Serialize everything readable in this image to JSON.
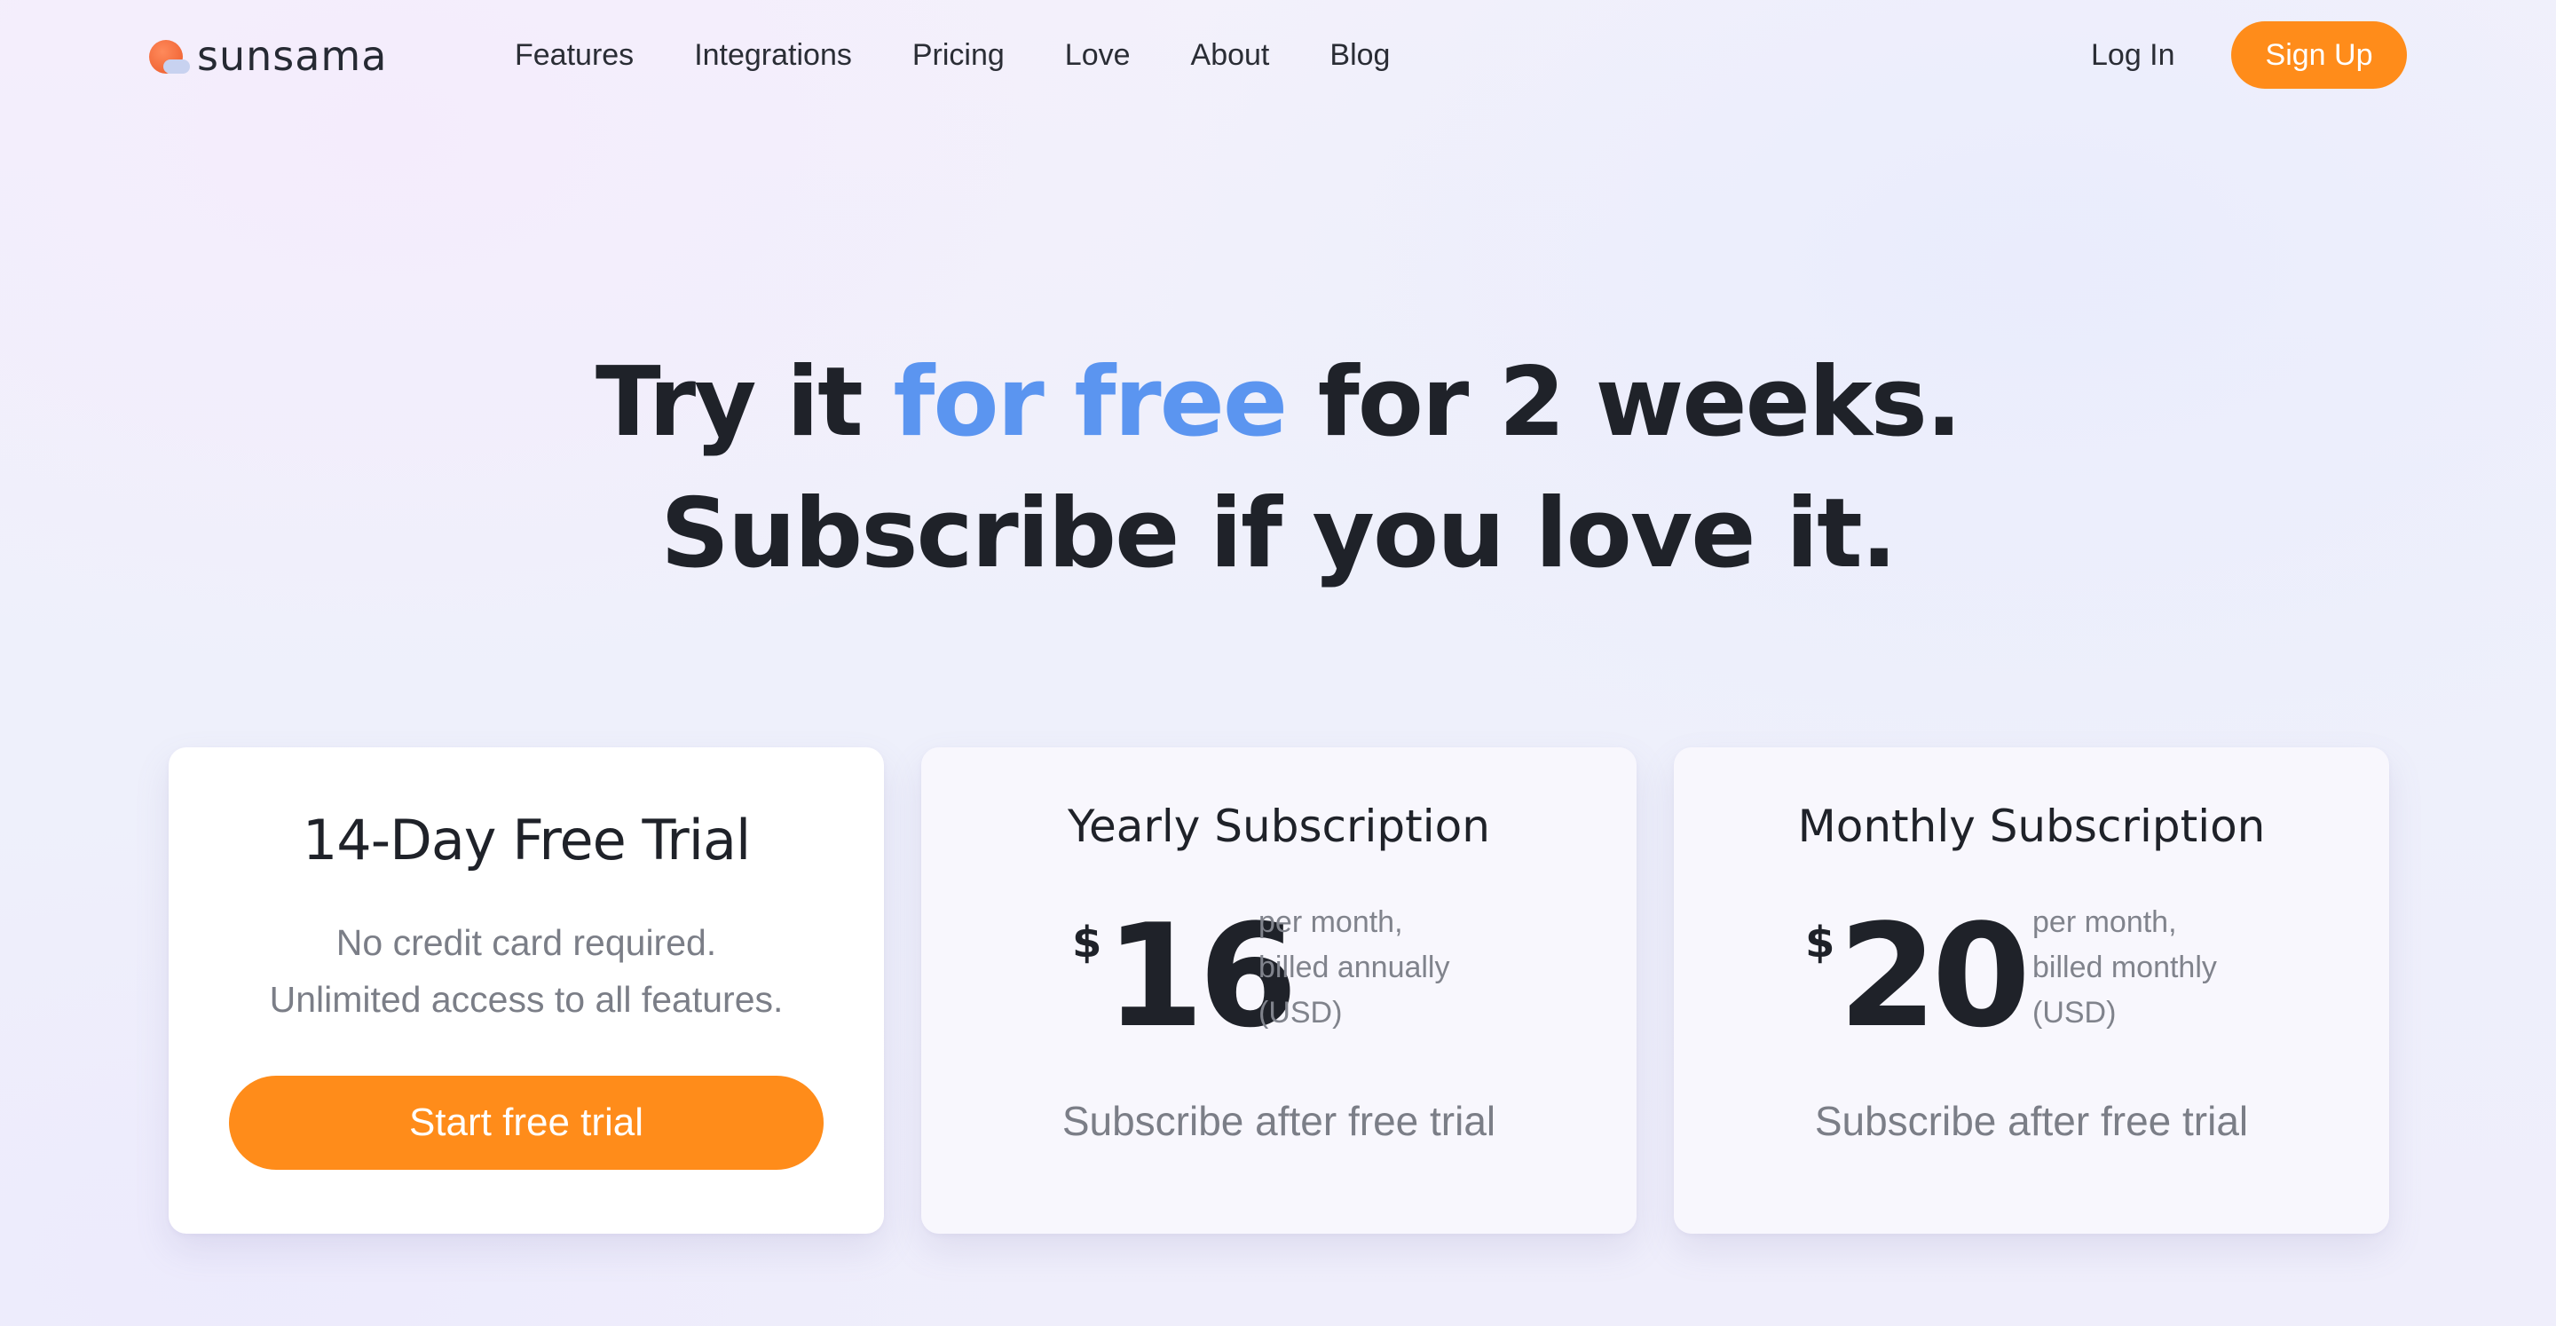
{
  "brand": {
    "name": "sunsama",
    "colors": {
      "accent": "#ff8c1a",
      "highlight": "#5b95f0",
      "text": "#1f2229"
    }
  },
  "nav": {
    "links": [
      "Features",
      "Integrations",
      "Pricing",
      "Love",
      "About",
      "Blog"
    ],
    "login": "Log In",
    "signup": "Sign Up"
  },
  "hero": {
    "line1_before": "Try it ",
    "line1_accent": "for free",
    "line1_after": " for 2 weeks.",
    "line2": "Subscribe if you love it."
  },
  "plans": {
    "trial": {
      "title": "14-Day Free Trial",
      "desc_line1": "No credit card required.",
      "desc_line2": "Unlimited access to all features.",
      "button": "Start free trial"
    },
    "yearly": {
      "title": "Yearly Subscription",
      "currency": "$",
      "price": "16",
      "note": "per month,\nbilled annually\n(USD)",
      "subscribe": "Subscribe after free trial"
    },
    "monthly": {
      "title": "Monthly Subscription",
      "currency": "$",
      "price": "20",
      "note": "per month,\nbilled monthly\n(USD)",
      "subscribe": "Subscribe after free trial"
    }
  }
}
